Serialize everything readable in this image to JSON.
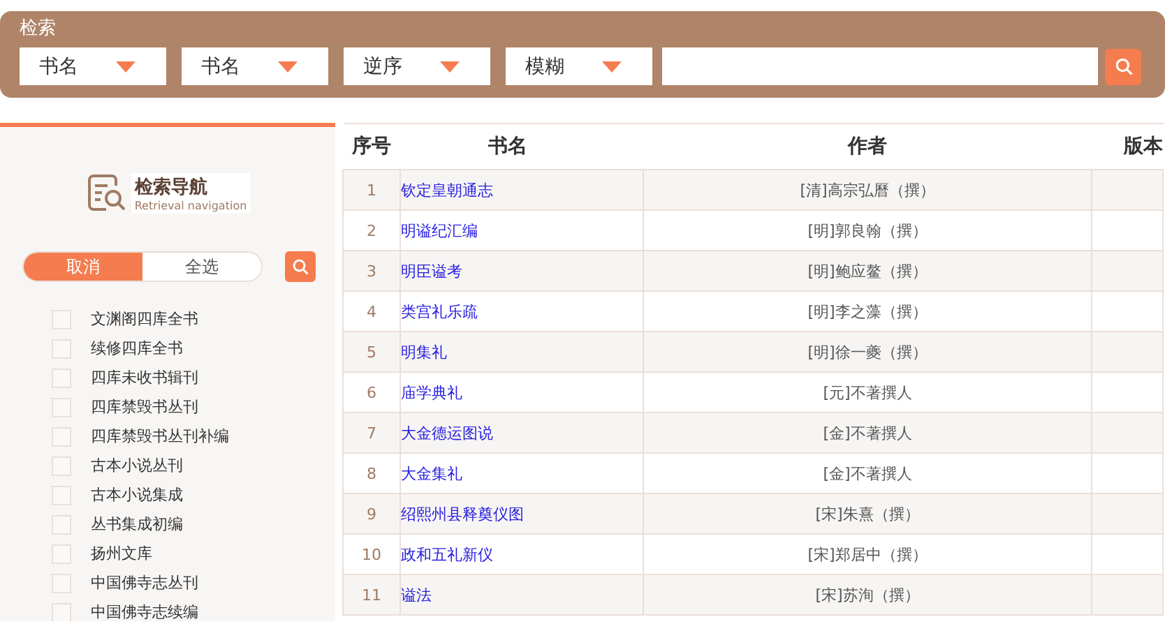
{
  "search_bar": {
    "title": "检索",
    "dropdowns": [
      {
        "value": "书名"
      },
      {
        "value": "书名"
      },
      {
        "value": "逆序"
      },
      {
        "value": "模糊"
      }
    ]
  },
  "sidebar": {
    "logo": {
      "title": "检索导航",
      "subtitle": "Retrieval navigation"
    },
    "toggle": [
      {
        "label": "取消",
        "selected": true
      },
      {
        "label": "全选",
        "selected": false
      }
    ],
    "collections": [
      {
        "label": "文渊阁四库全书",
        "checked": false
      },
      {
        "label": "续修四库全书",
        "checked": false
      },
      {
        "label": "四库未收书辑刊",
        "checked": false
      },
      {
        "label": "四库禁毁书丛刊",
        "checked": false
      },
      {
        "label": "四库禁毁书丛刊补编",
        "checked": false
      },
      {
        "label": "古本小说丛刊",
        "checked": false
      },
      {
        "label": "古本小说集成",
        "checked": false
      },
      {
        "label": "丛书集成初编",
        "checked": false
      },
      {
        "label": "扬州文库",
        "checked": false
      },
      {
        "label": "中国佛寺志丛刊",
        "checked": false
      },
      {
        "label": "中国佛寺志续编",
        "checked": false
      }
    ]
  },
  "table": {
    "columns": [
      "序号",
      "书名",
      "作者",
      "版本"
    ],
    "rows": [
      {
        "no": "1",
        "title": "钦定皇朝通志",
        "author": "[清]高宗弘曆（撰）"
      },
      {
        "no": "2",
        "title": "明谥纪汇编",
        "author": "[明]郭良翰（撰）"
      },
      {
        "no": "3",
        "title": "明臣谥考",
        "author": "[明]鲍应鳌（撰）"
      },
      {
        "no": "4",
        "title": "类宫礼乐疏",
        "author": "[明]李之藻（撰）"
      },
      {
        "no": "5",
        "title": "明集礼",
        "author": "[明]徐一夔（撰）"
      },
      {
        "no": "6",
        "title": "庙学典礼",
        "author": "[元]不著撰人"
      },
      {
        "no": "7",
        "title": "大金德运图说",
        "author": "[金]不著撰人"
      },
      {
        "no": "8",
        "title": "大金集礼",
        "author": "[金]不著撰人"
      },
      {
        "no": "9",
        "title": "绍熙州县释奠仪图",
        "author": "[宋]朱熹（撰）"
      },
      {
        "no": "10",
        "title": "政和五礼新仪",
        "author": "[宋]郑居中（撰）"
      },
      {
        "no": "11",
        "title": "谥法",
        "author": "[宋]苏洵（撰）"
      }
    ]
  }
}
